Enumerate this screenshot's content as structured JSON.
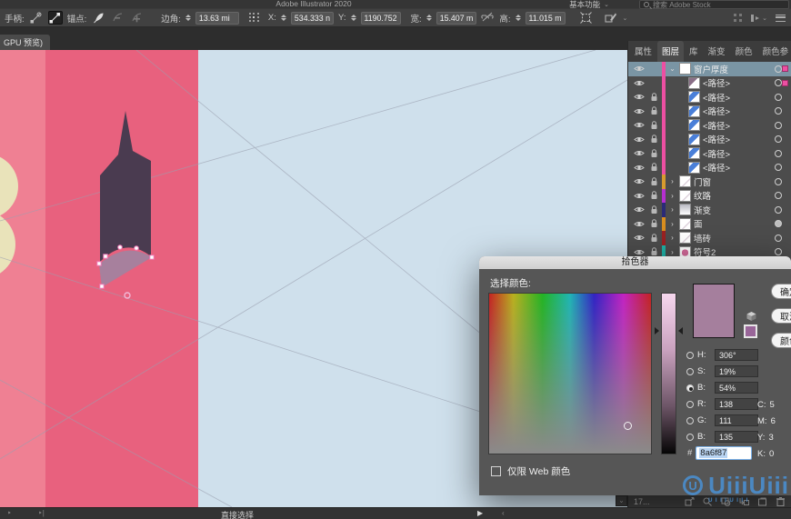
{
  "window": {
    "title": "Adobe Illustrator 2020",
    "workspace": "基本功能",
    "search_placeholder": "搜索 Adobe Stock"
  },
  "control_bar": {
    "handles_label": "手柄:",
    "anchor_label": "锚点:",
    "corner_label": "边角:",
    "corner_value": "13.63 mi",
    "x_label": "X:",
    "x_value": "534.333 n",
    "y_label": "Y:",
    "y_value": "1190.752",
    "width_label": "宽:",
    "width_value": "15.407 m",
    "height_label": "高:",
    "height_value": "11.015 m"
  },
  "document_tab": {
    "label": "GPU 预览)"
  },
  "layers_panel": {
    "tabs": [
      {
        "label": "属性"
      },
      {
        "label": "图层"
      },
      {
        "label": "库"
      },
      {
        "label": "渐变"
      },
      {
        "label": "颜色"
      },
      {
        "label": "颜色参"
      }
    ],
    "rows": [
      {
        "name": "窗户厚度",
        "kind": "group",
        "bar": "#ed4fa2",
        "lock": false,
        "chevron": "open",
        "thumb": "blank",
        "selected": true,
        "indicator": true,
        "target": "ring"
      },
      {
        "name": "<路径>",
        "kind": "path",
        "bar": "#ed4fa2",
        "lock": false,
        "thumb": "diag-purple",
        "indicator": true,
        "target": "ring"
      },
      {
        "name": "<路径>",
        "kind": "path",
        "bar": "#ed4fa2",
        "lock": true,
        "thumb": "diag-blue",
        "target": "ring"
      },
      {
        "name": "<路径>",
        "kind": "path",
        "bar": "#ed4fa2",
        "lock": true,
        "thumb": "diag-blue",
        "target": "ring"
      },
      {
        "name": "<路径>",
        "kind": "path",
        "bar": "#ed4fa2",
        "lock": true,
        "thumb": "diag-blue",
        "target": "ring"
      },
      {
        "name": "<路径>",
        "kind": "path",
        "bar": "#ed4fa2",
        "lock": true,
        "thumb": "diag-blue",
        "target": "ring"
      },
      {
        "name": "<路径>",
        "kind": "path",
        "bar": "#ed4fa2",
        "lock": true,
        "thumb": "diag-blue",
        "target": "ring"
      },
      {
        "name": "<路径>",
        "kind": "path",
        "bar": "#ed4fa2",
        "lock": true,
        "thumb": "diag-blue",
        "target": "ring"
      },
      {
        "name": "门窗",
        "kind": "layer",
        "bar": "#d79b2e",
        "lock": true,
        "chevron": "closed",
        "thumb": "sketch",
        "target": "ring"
      },
      {
        "name": "纹路",
        "kind": "layer",
        "bar": "#b52fd0",
        "lock": true,
        "chevron": "closed",
        "thumb": "sketch",
        "target": "ring"
      },
      {
        "name": "渐变",
        "kind": "layer",
        "bar": "#2b2b77",
        "lock": true,
        "chevron": "closed",
        "thumb": "grad",
        "target": "ring"
      },
      {
        "name": "面",
        "kind": "layer",
        "bar": "#d98e1f",
        "lock": true,
        "chevron": "closed",
        "thumb": "sketch",
        "target": "filled"
      },
      {
        "name": "墙砖",
        "kind": "layer",
        "bar": "#992222",
        "lock": true,
        "chevron": "closed",
        "thumb": "sketch",
        "target": "ring"
      },
      {
        "name": "符号2",
        "kind": "layer",
        "bar": "#1fb3a7",
        "lock": true,
        "chevron": "closed",
        "thumb": "pink",
        "target": "ring"
      }
    ],
    "footer": {
      "count": "17..."
    }
  },
  "color_picker": {
    "title": "拾色器",
    "select_label": "选择颜色:",
    "buttons": [
      {
        "label": "确定"
      },
      {
        "label": "取消"
      },
      {
        "label": "颜色库"
      }
    ],
    "hsb": [
      {
        "label": "H:",
        "value": "306°"
      },
      {
        "label": "S:",
        "value": "19%"
      },
      {
        "label": "B:",
        "value": "54%"
      }
    ],
    "rgb": [
      {
        "label": "R:",
        "value": "138"
      },
      {
        "label": "G:",
        "value": "111"
      },
      {
        "label": "B:",
        "value": "135"
      }
    ],
    "hex_prefix": "#",
    "hex_value": "8a6f87",
    "cmyk": [
      {
        "label": "C:",
        "value": "5"
      },
      {
        "label": "M:",
        "value": "6"
      },
      {
        "label": "Y:",
        "value": "3"
      },
      {
        "label": "K:",
        "value": "0"
      }
    ],
    "web_only_label": "仅限 Web 颜色",
    "preview_color": "#a57f9d",
    "web_swatch_color": "#996699"
  },
  "status_bar": {
    "tool": "直接选择"
  },
  "watermark": {
    "text": "UiiiUiii",
    "sub": "UIIIUIII"
  },
  "colors": {
    "canvas-blue": "#cfe0ec",
    "canvas-pink": "#e8617e",
    "canvas-salmon": "#ef8093",
    "canvas-yellow": "#e9e3ba",
    "tower": "#4a3b50",
    "arch": "#a183a0",
    "guide": "#9aa0b0",
    "accent-pink": "#ed4fa2",
    "selection-blue": "#7a95a4"
  }
}
